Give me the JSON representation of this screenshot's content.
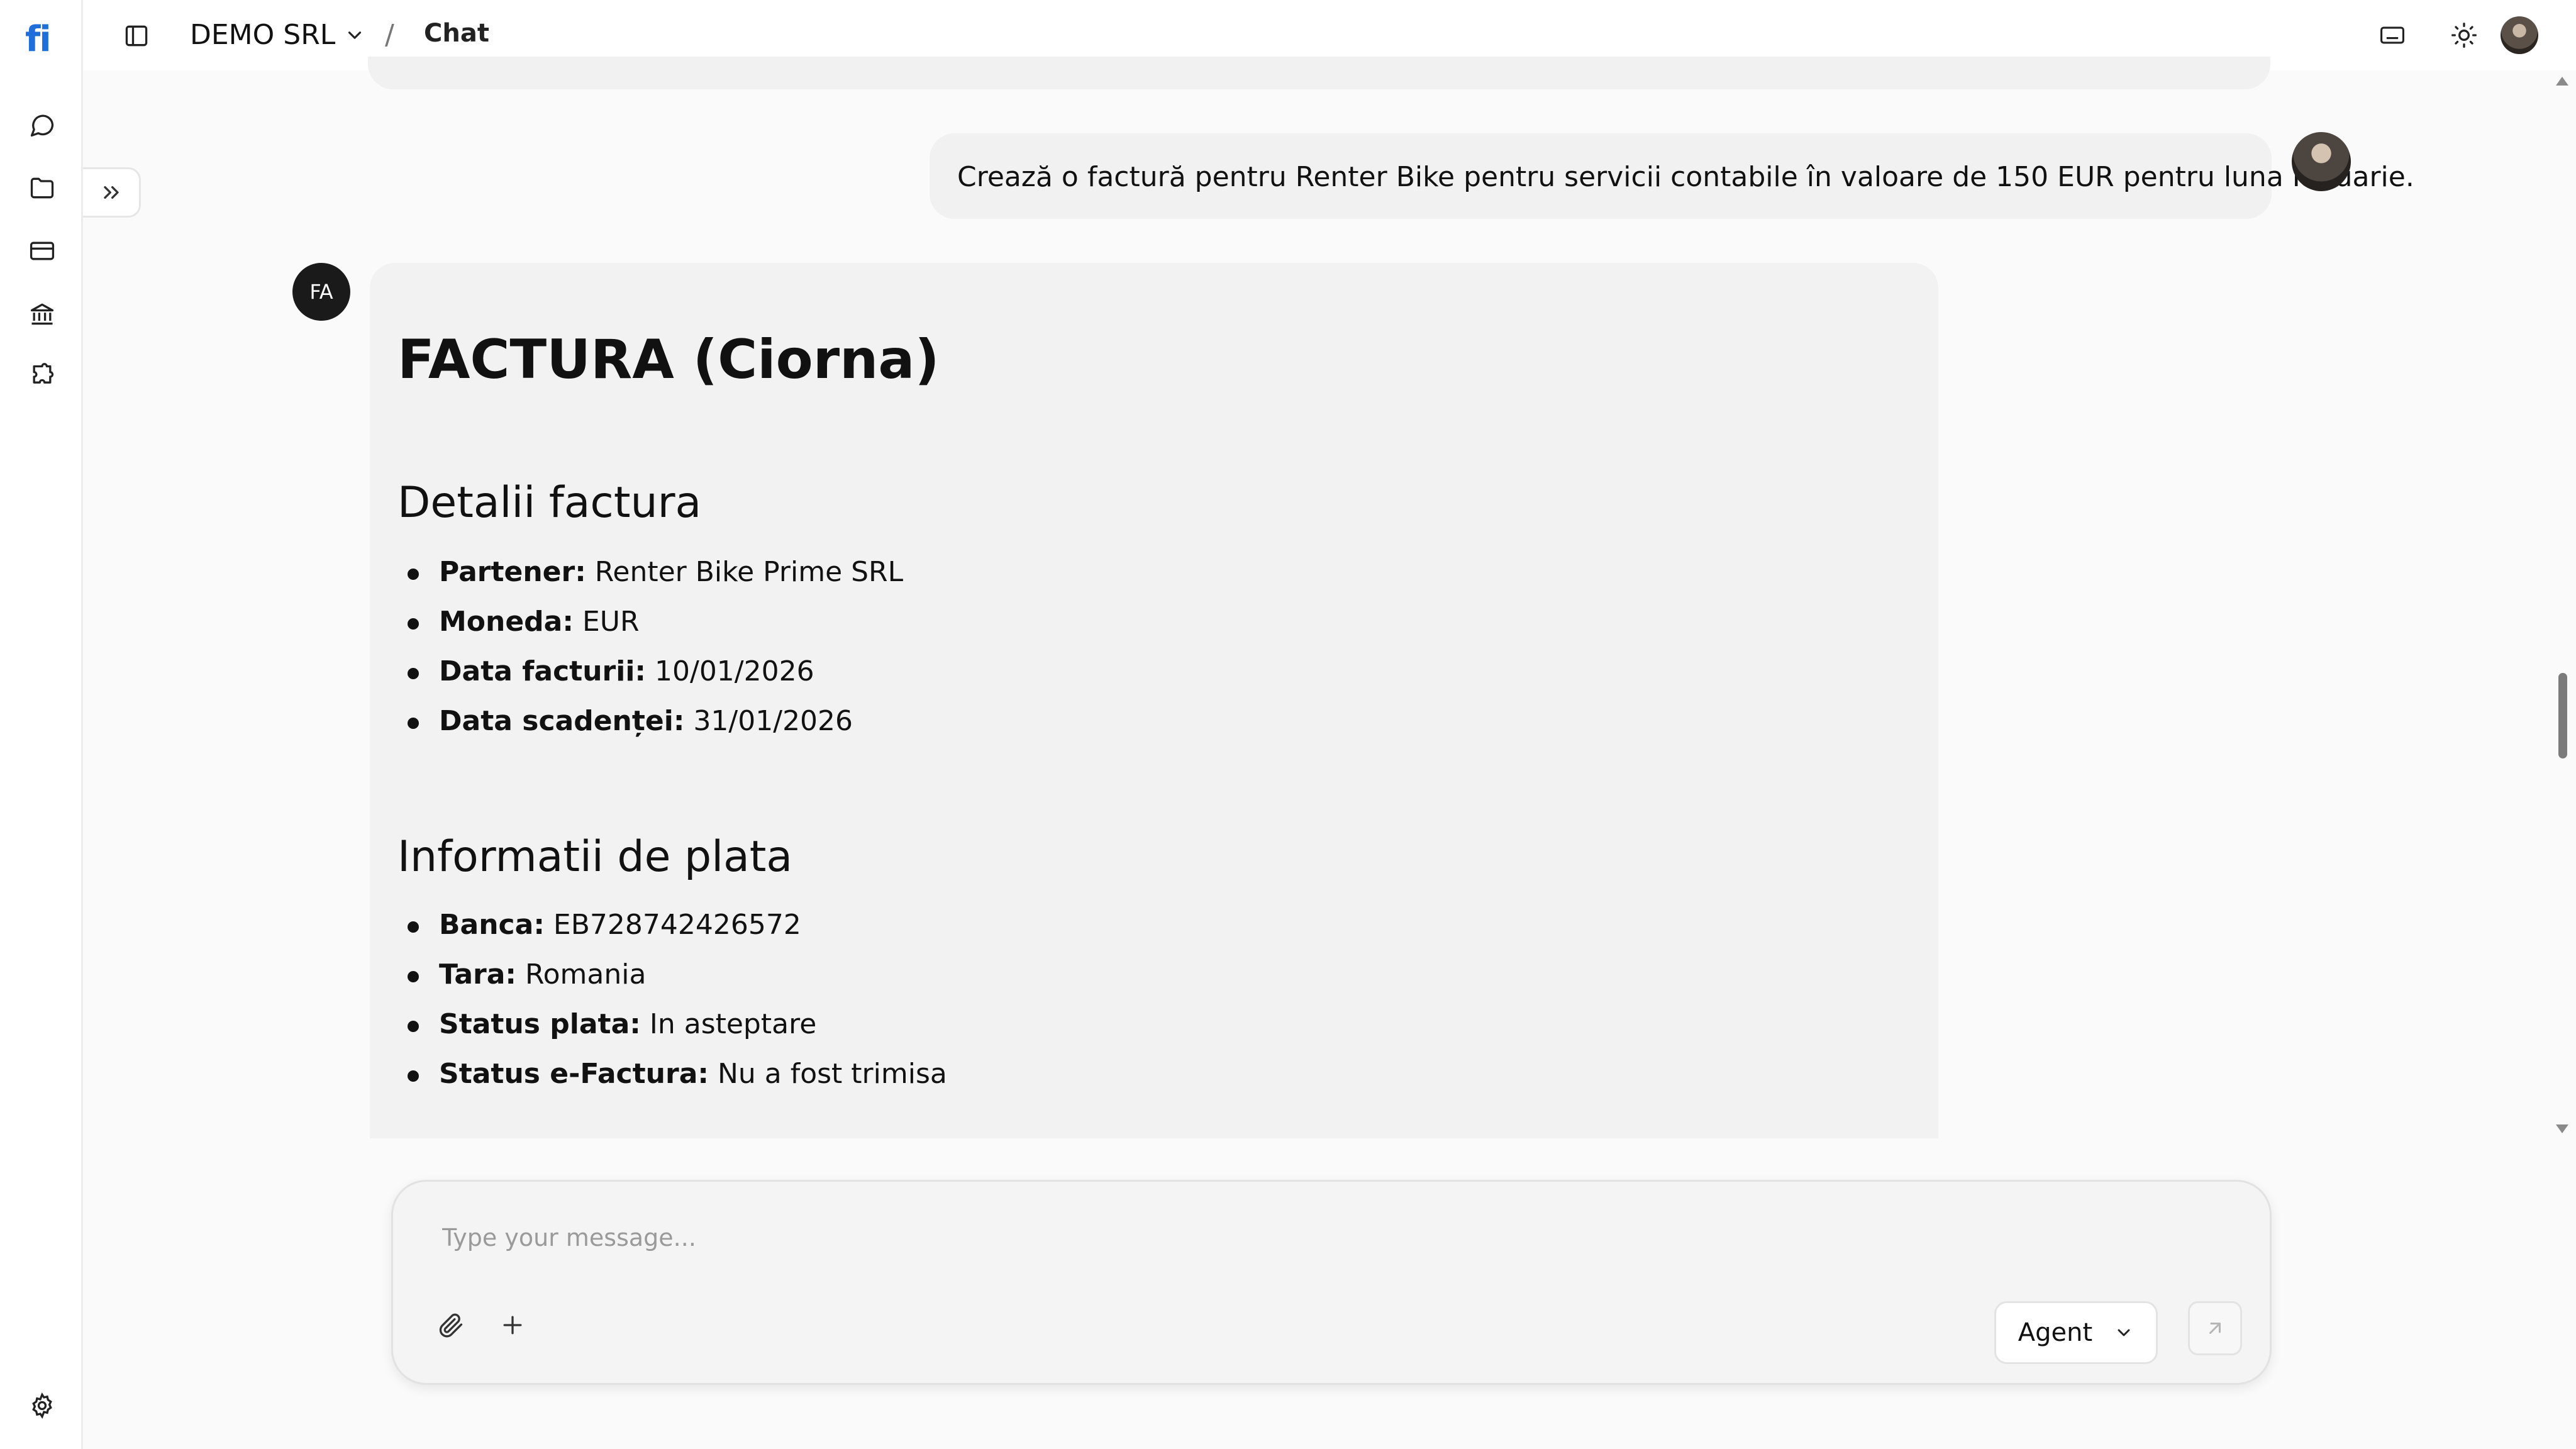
{
  "app": {
    "logo": "fi"
  },
  "header": {
    "company": "DEMO SRL",
    "separator": "/",
    "breadcrumb": "Chat"
  },
  "chat": {
    "user_message": "Crează o factură pentru Renter Bike pentru servicii contabile în valoare de 150 EUR pentru luna Ianuarie.",
    "agent_initials": "FA",
    "invoice": {
      "title": "FACTURA (Ciorna)",
      "details_heading": "Detalii factura",
      "details": [
        {
          "label": "Partener:",
          "value": "Renter Bike Prime SRL"
        },
        {
          "label": "Moneda:",
          "value": "EUR"
        },
        {
          "label": "Data facturii:",
          "value": "10/01/2026"
        },
        {
          "label": "Data scadenței:",
          "value": "31/01/2026"
        }
      ],
      "payment_heading": "Informatii de plata",
      "payment": [
        {
          "label": "Banca:",
          "value": "EB728742426572"
        },
        {
          "label": "Tara:",
          "value": "Romania"
        },
        {
          "label": "Status plata:",
          "value": "In asteptare"
        },
        {
          "label": "Status e-Factura:",
          "value": "Nu a fost trimisa"
        }
      ]
    }
  },
  "composer": {
    "placeholder": "Type your message...",
    "mode": "Agent"
  },
  "colors": {
    "brand": "#1e6fd9",
    "agent_avatar": "#1a1a1a",
    "bubble": "#f1f1f1"
  },
  "icons": {
    "rail": [
      "chat-icon",
      "folder-icon",
      "credit-card-icon",
      "bank-icon",
      "puzzle-icon",
      "settings-icon"
    ],
    "header": [
      "sidebar-toggle-icon",
      "chevron-down-icon",
      "keyboard-icon",
      "sun-icon"
    ],
    "composer": [
      "paperclip-icon",
      "plus-icon",
      "chevron-down-icon",
      "send-arrow-icon"
    ]
  }
}
